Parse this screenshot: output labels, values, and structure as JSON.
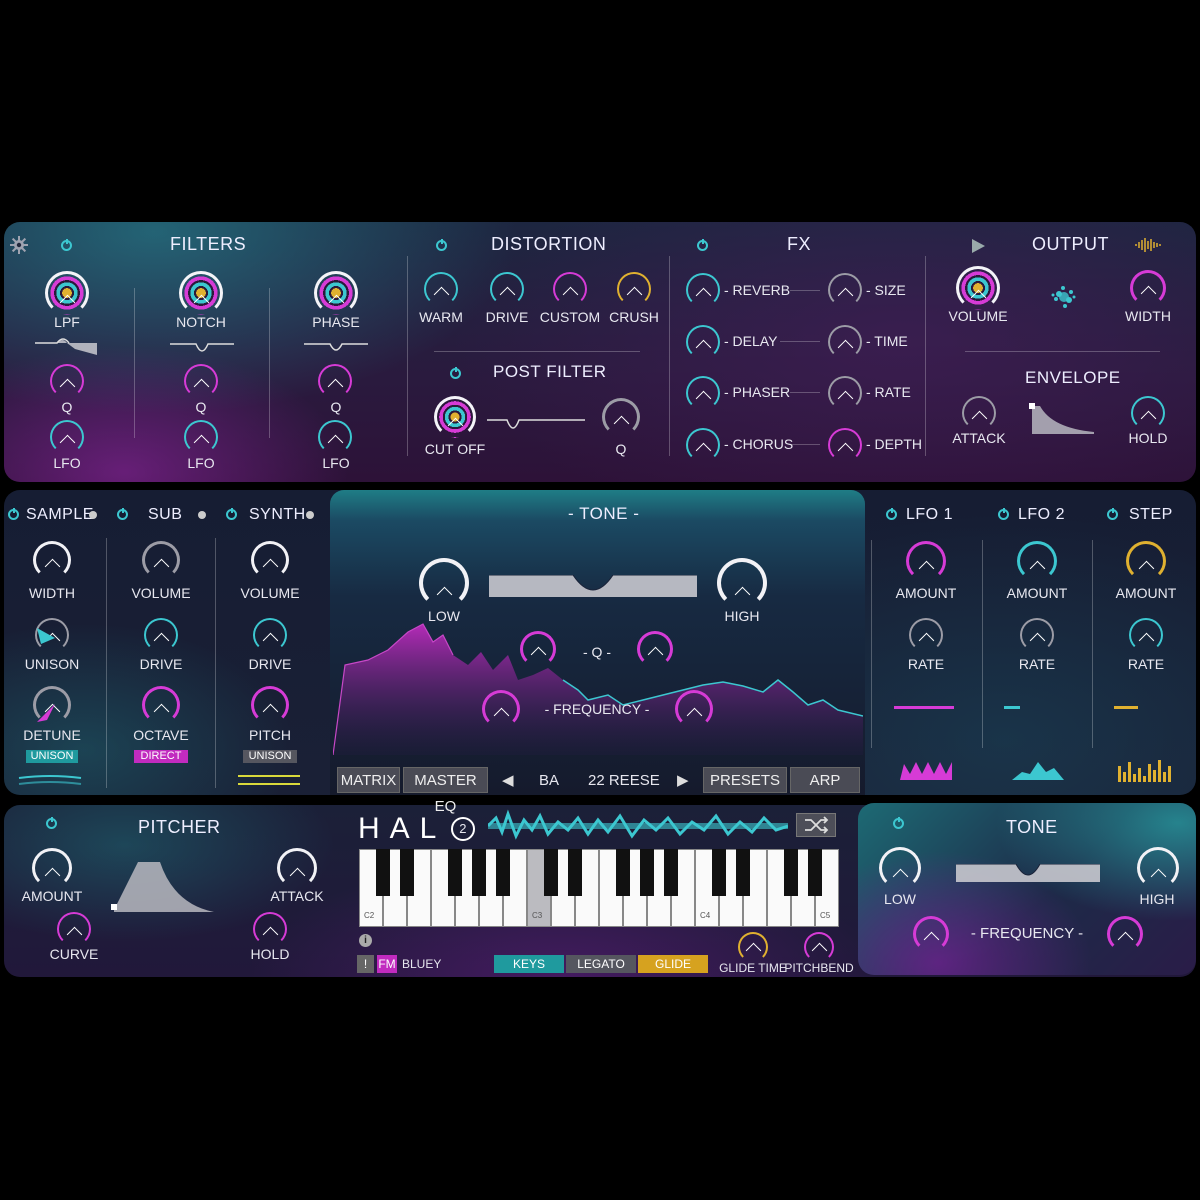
{
  "colors": {
    "magenta": "#d63bd6",
    "teal": "#3cc7d0",
    "gold": "#e0b130",
    "grey": "#9c9ca6"
  },
  "filters": {
    "title": "FILTERS",
    "lpf": "LPF",
    "notch": "NOTCH",
    "phase": "PHASE",
    "q": "Q",
    "lfo": "LFO"
  },
  "distortion": {
    "title": "DISTORTION",
    "warm": "WARM",
    "drive": "DRIVE",
    "custom": "CUSTOM",
    "crush": "CRUSH"
  },
  "post_filter": {
    "title": "POST FILTER",
    "cutoff": "CUT OFF",
    "q": "Q"
  },
  "fx": {
    "title": "FX",
    "reverb": "- REVERB",
    "delay": "- DELAY",
    "phaser": "- PHASER",
    "chorus": "- CHORUS",
    "size": "- SIZE",
    "time": "- TIME",
    "rate": "- RATE",
    "depth": "- DEPTH"
  },
  "output": {
    "title": "OUTPUT",
    "volume": "VOLUME",
    "width": "WIDTH"
  },
  "envelope": {
    "title": "ENVELOPE",
    "attack": "ATTACK",
    "hold": "HOLD"
  },
  "sample": {
    "title": "SAMPLE",
    "width": "WIDTH",
    "unison": "UNISON",
    "detune": "DETUNE",
    "tag": "UNISON"
  },
  "sub": {
    "title": "SUB",
    "volume": "VOLUME",
    "drive": "DRIVE",
    "octave": "OCTAVE",
    "tag": "DIRECT"
  },
  "synth": {
    "title": "SYNTH",
    "volume": "VOLUME",
    "drive": "DRIVE",
    "pitch": "PITCH",
    "tag": "UNISON"
  },
  "tone_mid": {
    "title": "- TONE -",
    "low": "LOW",
    "high": "HIGH",
    "q": "- Q -",
    "frequency": "- FREQUENCY -"
  },
  "lfo1": {
    "title": "LFO 1",
    "amount": "AMOUNT",
    "rate": "RATE"
  },
  "lfo2": {
    "title": "LFO 2",
    "amount": "AMOUNT",
    "rate": "RATE"
  },
  "step": {
    "title": "STEP",
    "amount": "AMOUNT",
    "rate": "RATE"
  },
  "toolbar": {
    "matrix": "MATRIX",
    "master_eq": "MASTER EQ",
    "prev": "◀",
    "bank": "BA",
    "preset_name": "22 REESE",
    "next": "▶",
    "presets": "PRESETS",
    "arp": "ARP"
  },
  "pitcher": {
    "title": "PITCHER",
    "amount": "AMOUNT",
    "attack": "ATTACK",
    "curve": "CURVE",
    "hold": "HOLD"
  },
  "logo": {
    "text": "HAL",
    "badge": "2"
  },
  "keyboard": {
    "c2": "C2",
    "c3": "C3",
    "c4": "C4",
    "c5": "C5"
  },
  "bottom_bar": {
    "warn": "!",
    "fm": "FM",
    "author": "BLUEY",
    "keys": "KEYS",
    "legato": "LEGATO",
    "glide": "GLIDE",
    "glide_time": "GLIDE TIME",
    "pitchbend": "PITCHBEND",
    "info": "i"
  },
  "tone_bot": {
    "title": "TONE",
    "low": "LOW",
    "high": "HIGH",
    "frequency": "- FREQUENCY -"
  }
}
